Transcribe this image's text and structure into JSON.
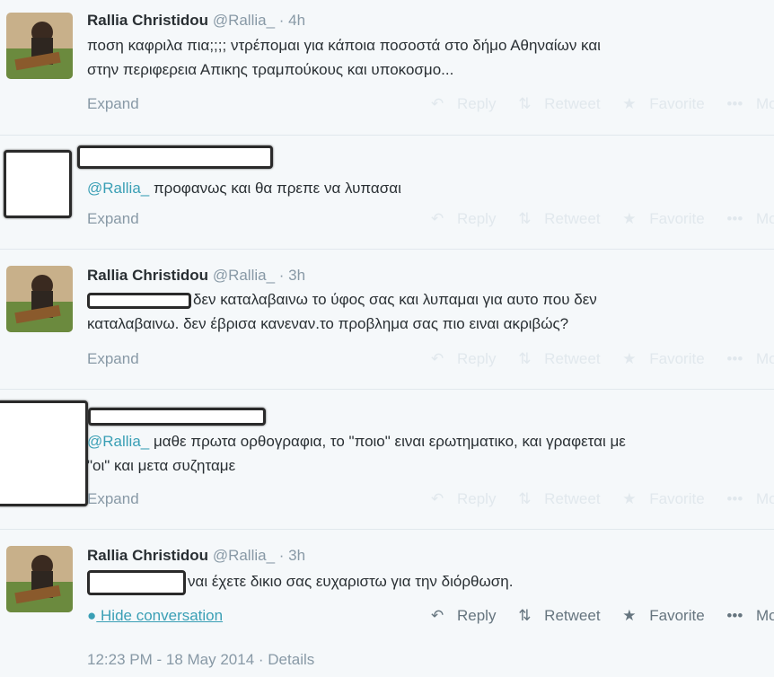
{
  "tweets": [
    {
      "name": "Rallia Christidou",
      "handle": "@Rallia_",
      "time": "· 4h",
      "line1": "ποση καφριλα πια;;;; ντρέπομαι για κάποια ποσοστά στο δήμο Αθηναίων και",
      "line2": "στην περιφερεια Απικης τραμπούκους και υποκοσμο...",
      "expand": "Expand"
    },
    {
      "mention": "@Rallia_",
      "line1": " προφανως και θα πρεπε να λυπασαι",
      "expand": "Expand"
    },
    {
      "name": "Rallia Christidou",
      "handle": "@Rallia_",
      "time": "· 3h",
      "line1": "δεν καταλαβαινω το ύφος σας και λυπαμαι για αυτο που δεν",
      "line2": "καταλαβαινω. δεν έβρισα κανεναν.το προβλημα σας πιο ειναι ακριβώς?",
      "expand": "Expand"
    },
    {
      "mention": "@Rallia_",
      "line1": " μαθε πρωτα ορθογραφια, το \"ποιο\" ειναι ερωτηματικο, και γραφεται με",
      "line2": "\"οι\" και μετα συζηταμε",
      "expand": "Expand"
    },
    {
      "name": "Rallia Christidou",
      "handle": "@Rallia_",
      "time": "· 3h",
      "line1": "ναι έχετε δικιο σας ευχαριστω για την διόρθωση.",
      "hide": "Hide conversation"
    }
  ],
  "actions": {
    "reply": "Reply",
    "retweet": "Retweet",
    "favorite": "Favorite",
    "more": "More"
  },
  "footer": {
    "timestamp": "12:23 PM - 18 May 2014",
    "details": "Details",
    "separator": " · "
  },
  "icons": [
    "reply-icon",
    "retweet-icon",
    "favorite-icon",
    "more-icon",
    "speech-bubble-icon"
  ],
  "colors": {
    "mention": "#3a9fb5",
    "muted": "#8899a6",
    "text": "#292f33"
  }
}
